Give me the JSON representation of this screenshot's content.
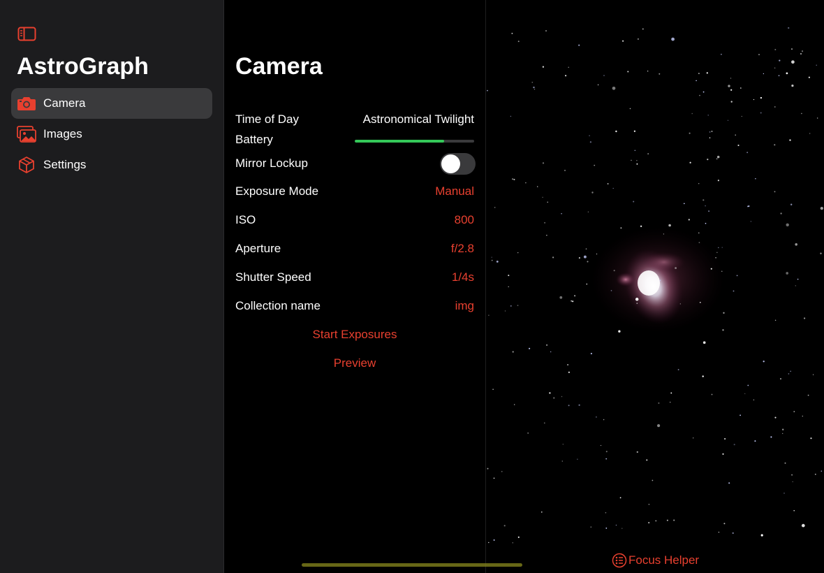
{
  "colors": {
    "accent": "#e8402f",
    "battery": "#34c759",
    "sidebar_bg": "#1c1c1e",
    "selected_bg": "#3a3a3c"
  },
  "sidebar": {
    "toggle_icon": "sidebar-icon",
    "title": "AstroGraph",
    "items": [
      {
        "label": "Camera",
        "icon": "camera-icon",
        "selected": true
      },
      {
        "label": "Images",
        "icon": "photos-icon",
        "selected": false
      },
      {
        "label": "Settings",
        "icon": "cube-icon",
        "selected": false
      }
    ]
  },
  "camera": {
    "title": "Camera",
    "time_of_day": {
      "label": "Time of Day",
      "value": "Astronomical Twilight"
    },
    "battery": {
      "label": "Battery",
      "level": 0.75
    },
    "mirror_lockup": {
      "label": "Mirror Lockup",
      "on": false
    },
    "exposure_mode": {
      "label": "Exposure Mode",
      "value": "Manual"
    },
    "iso": {
      "label": "ISO",
      "value": "800"
    },
    "aperture": {
      "label": "Aperture",
      "value": "f/2.8"
    },
    "shutter_speed": {
      "label": "Shutter Speed",
      "value": "1/4s"
    },
    "collection_name": {
      "label": "Collection name",
      "value": "img"
    },
    "start_exposures": "Start Exposures",
    "preview": "Preview"
  },
  "preview_pane": {
    "image": "orion-nebula-starfield",
    "focus_helper": {
      "label": "Focus Helper",
      "icon": "focus-icon"
    }
  }
}
